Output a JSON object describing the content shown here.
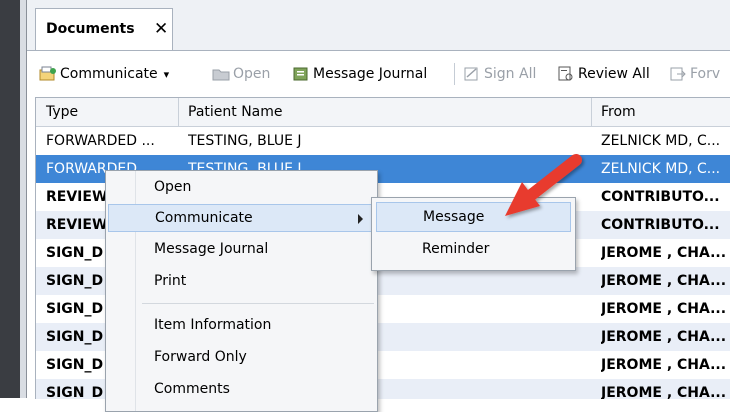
{
  "tab": {
    "title": "Documents",
    "close_glyph": "✕"
  },
  "toolbar": {
    "communicate": "Communicate",
    "dropdown_glyph": "▾",
    "open": "Open",
    "message_journal": "Message Journal",
    "sign_all": "Sign All",
    "review_all": "Review All",
    "forward": "Forv"
  },
  "grid": {
    "columns": [
      "Type",
      "Patient Name",
      "From"
    ],
    "rows": [
      {
        "type": "FORWARDED ...",
        "patient": "TESTING, BLUE J",
        "from": "ZELNICK MD, C...",
        "bold": false,
        "selected": false
      },
      {
        "type": "FORWARDED ...",
        "patient": "TESTING, BLUE J",
        "from": "ZELNICK MD, C...",
        "bold": false,
        "selected": true
      },
      {
        "type": "REVIEW",
        "patient": "",
        "from": "CONTRIBUTO...",
        "bold": true,
        "selected": false
      },
      {
        "type": "REVIEW",
        "patient": "",
        "from": "CONTRIBUTO...",
        "bold": true,
        "selected": false
      },
      {
        "type": "SIGN_D",
        "patient": "",
        "from": "JEROME , CHA...",
        "bold": true,
        "selected": false
      },
      {
        "type": "SIGN_D",
        "patient": "",
        "from": "JEROME , CHA...",
        "bold": true,
        "selected": false
      },
      {
        "type": "SIGN_D",
        "patient": "",
        "from": "JEROME , CHA...",
        "bold": true,
        "selected": false
      },
      {
        "type": "SIGN_D",
        "patient": "",
        "from": "JEROME , CHA...",
        "bold": true,
        "selected": false
      },
      {
        "type": "SIGN_D",
        "patient": "",
        "from": "JEROME , CHA...",
        "bold": true,
        "selected": false
      },
      {
        "type": "SIGN_D",
        "patient": "",
        "from": "JEROME , CHA...",
        "bold": true,
        "selected": false
      }
    ]
  },
  "context_menu": {
    "open": "Open",
    "communicate": "Communicate",
    "message_journal": "Message Journal",
    "print": "Print",
    "item_information": "Item Information",
    "forward_only": "Forward Only",
    "comments": "Comments"
  },
  "submenu": {
    "message": "Message",
    "reminder": "Reminder"
  },
  "colors": {
    "selection": "#3e86d6",
    "hover": "#dce8f7",
    "annotation_arrow": "#e83a2e"
  }
}
